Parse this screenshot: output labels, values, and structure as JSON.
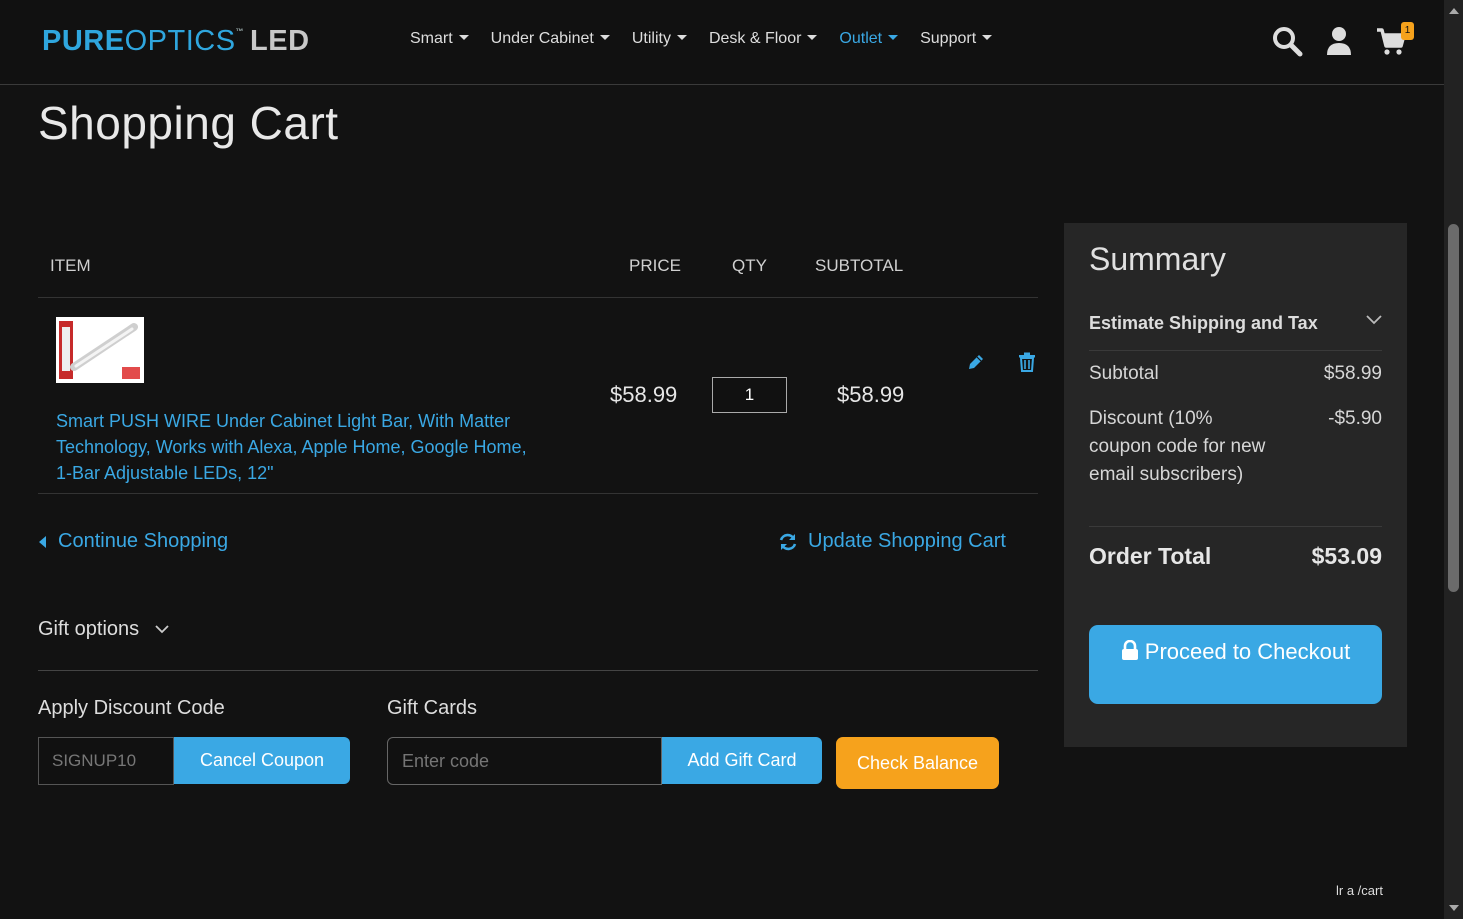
{
  "header": {
    "logo": {
      "part1": "PURE",
      "part2": "OPTICS",
      "tm": "™",
      "part3": "LED"
    },
    "nav": [
      {
        "label": "Smart"
      },
      {
        "label": "Under Cabinet"
      },
      {
        "label": "Utility"
      },
      {
        "label": "Desk & Floor"
      },
      {
        "label": "Outlet",
        "active": true
      },
      {
        "label": "Support"
      }
    ],
    "cart_count": "1"
  },
  "page_title": "Shopping Cart",
  "cart_table": {
    "headers": {
      "item": "ITEM",
      "price": "PRICE",
      "qty": "QTY",
      "subtotal": "SUBTOTAL"
    },
    "items": [
      {
        "name": "Smart PUSH WIRE Under Cabinet Light Bar, With Matter Technology, Works with Alexa, Apple Home, Google Home, 1-Bar Adjustable LEDs, 12\"",
        "price": "$58.99",
        "qty": "1",
        "subtotal": "$58.99"
      }
    ]
  },
  "actions": {
    "continue": "Continue Shopping",
    "update": "Update Shopping Cart"
  },
  "gift_options": {
    "label": "Gift options"
  },
  "discount": {
    "title": "Apply Discount Code",
    "value": "SIGNUP10",
    "button": "Cancel Coupon"
  },
  "gift_cards": {
    "title": "Gift Cards",
    "placeholder": "Enter code",
    "add_button": "Add Gift Card",
    "check_button": "Check Balance"
  },
  "summary": {
    "title": "Summary",
    "estimate": "Estimate Shipping and Tax",
    "subtotal_label": "Subtotal",
    "subtotal_value": "$58.99",
    "discount_label": "Discount (10% coupon code for new email subscribers)",
    "discount_value": "-$5.90",
    "total_label": "Order Total",
    "total_value": "$53.09",
    "checkout": "Proceed to Checkout"
  },
  "status_url": "lr a /cart",
  "colors": {
    "accent": "#3aa8e4",
    "orange": "#f6a21c",
    "background": "#121212",
    "panel": "#262626"
  }
}
